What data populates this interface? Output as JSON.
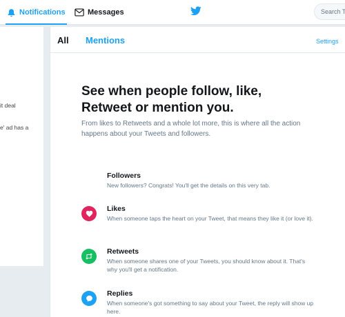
{
  "topnav": {
    "notifications_label": "Notifications",
    "messages_label": "Messages",
    "search_placeholder": "Search Tw",
    "accent_color": "#1da1f2"
  },
  "left_panel": {
    "snippet_1": "it deal",
    "snippet_2": "e' ad has a"
  },
  "tabs": {
    "all_label": "All",
    "mentions_label": "Mentions",
    "settings_label": "Settings"
  },
  "empty_state": {
    "headline": "See when people follow, like, Retweet or mention you.",
    "description": "From likes to Retweets and a whole lot more, this is where all the action happens about your Tweets and followers."
  },
  "features": [
    {
      "title": "Followers",
      "description": "New followers? Congrats! You'll get the details on this very tab.",
      "icon": "person-icon",
      "color": ""
    },
    {
      "title": "Likes",
      "description": "When someone taps the heart on your Tweet, that means they like it (or love it).",
      "icon": "heart-icon",
      "color": "#e0245e"
    },
    {
      "title": "Retweets",
      "description": "When someone shares one of your Tweets, you should know about it. That's why you'll get a notification.",
      "icon": "retweet-icon",
      "color": "#17bf63"
    },
    {
      "title": "Replies",
      "description": "When someone's got something to say about your Tweet, the reply will show up here.",
      "icon": "reply-icon",
      "color": "#1da1f2"
    }
  ]
}
